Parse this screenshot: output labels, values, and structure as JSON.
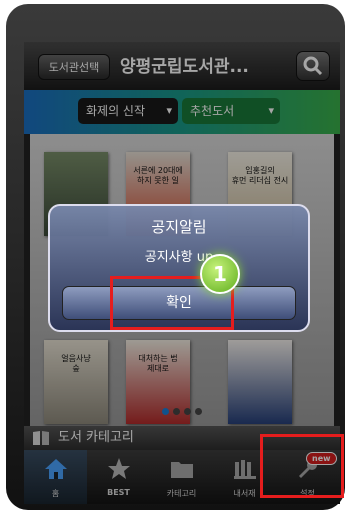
{
  "header": {
    "library_select_label": "도서관선택",
    "title": "양평군립도서관..."
  },
  "filters": {
    "first": "화제의 신작",
    "second": "추천도서"
  },
  "books": [
    {
      "text": ""
    },
    {
      "text": "서른에 20대에\n하지 못한 일"
    },
    {
      "text": "임홍길의\n휴먼 리더십 전시"
    },
    {
      "text": "얼음사냥\n숲"
    },
    {
      "text": "대처하는 법\n제대로"
    },
    {
      "text": ""
    }
  ],
  "category": {
    "label": "도서 카테고리"
  },
  "tabs": [
    {
      "label": "홈"
    },
    {
      "label": "BEST"
    },
    {
      "label": "카테고리"
    },
    {
      "label": "내서재"
    },
    {
      "label": "설정"
    }
  ],
  "settings_badge": "new",
  "dialog": {
    "title": "공지알림",
    "message": "공지사항 up",
    "ok_label": "확인"
  },
  "marker": "1",
  "colors": {
    "accent_blue": "#1a7fd8",
    "highlight_red": "#e51d1d"
  }
}
